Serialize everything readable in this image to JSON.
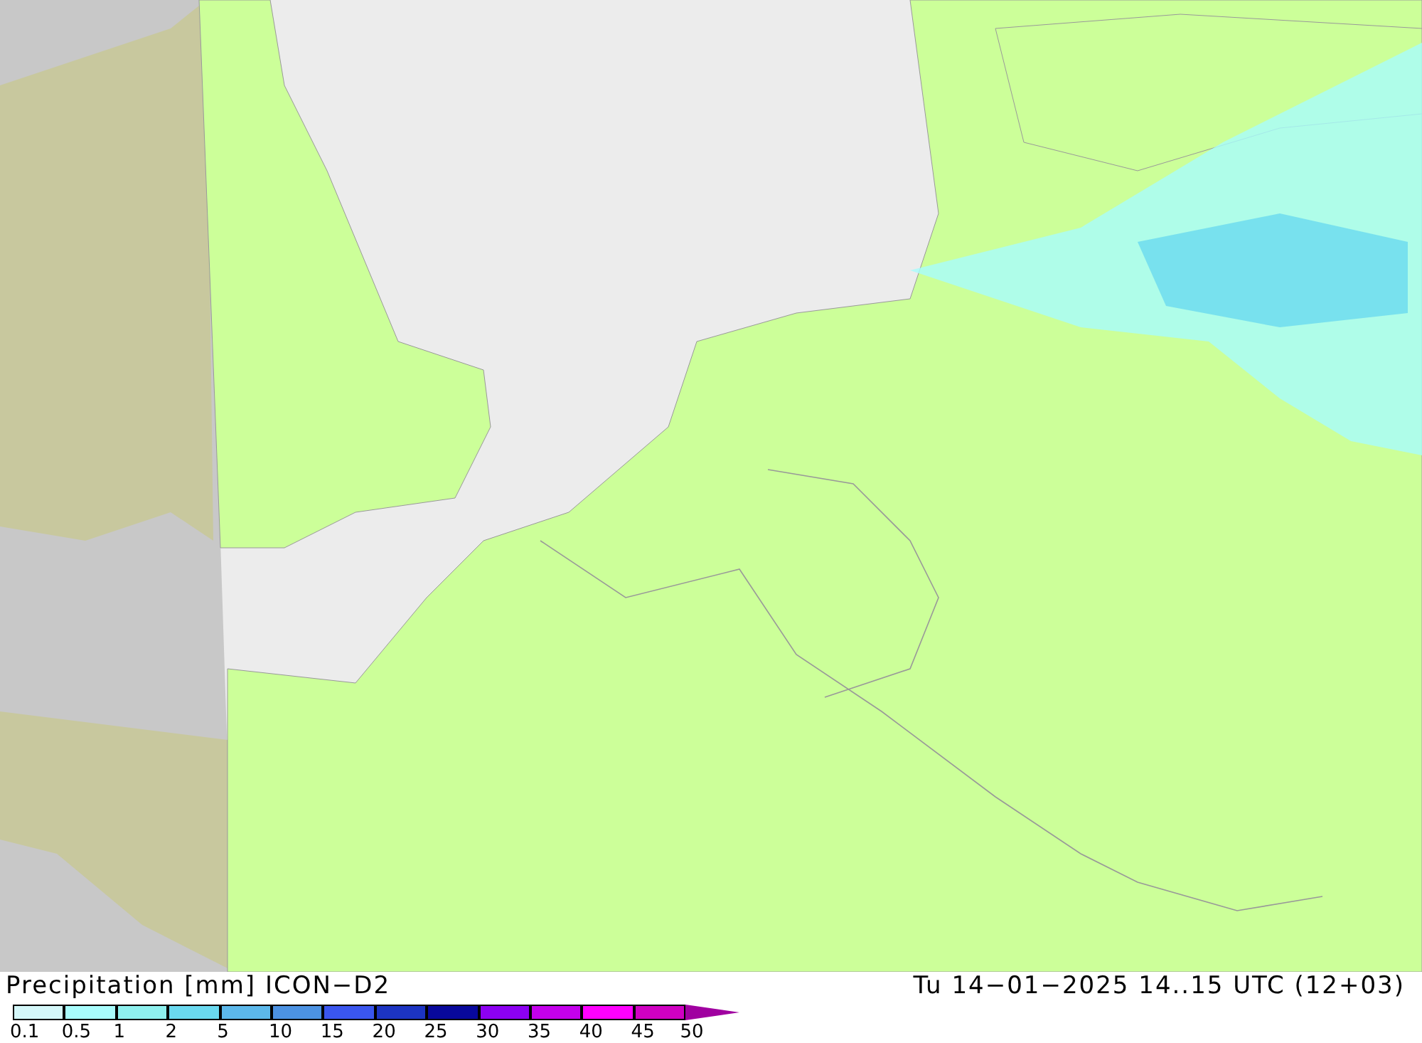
{
  "title": "Precipitation [mm] ICON−D2",
  "valid_time": "Tu 14−01−2025 14..15 UTC (12+03)",
  "legend": [
    {
      "color": "#d4f7f9",
      "label": "0.1"
    },
    {
      "color": "#a8fcfc",
      "label": "0.5"
    },
    {
      "color": "#8ef0ee",
      "label": "1"
    },
    {
      "color": "#6ad9ef",
      "label": "2"
    },
    {
      "color": "#5cb8ea",
      "label": "5"
    },
    {
      "color": "#4c92e2",
      "label": "10"
    },
    {
      "color": "#3a56ee",
      "label": "15"
    },
    {
      "color": "#1c34c2",
      "label": "20"
    },
    {
      "color": "#08089c",
      "label": "25"
    },
    {
      "color": "#8c00f2",
      "label": "30"
    },
    {
      "color": "#c400ec",
      "label": "35"
    },
    {
      "color": "#ff00ff",
      "label": "40"
    },
    {
      "color": "#d000c2",
      "label": "45"
    },
    {
      "kind": "arrow",
      "color": "#a000a0",
      "label": "50"
    }
  ]
}
